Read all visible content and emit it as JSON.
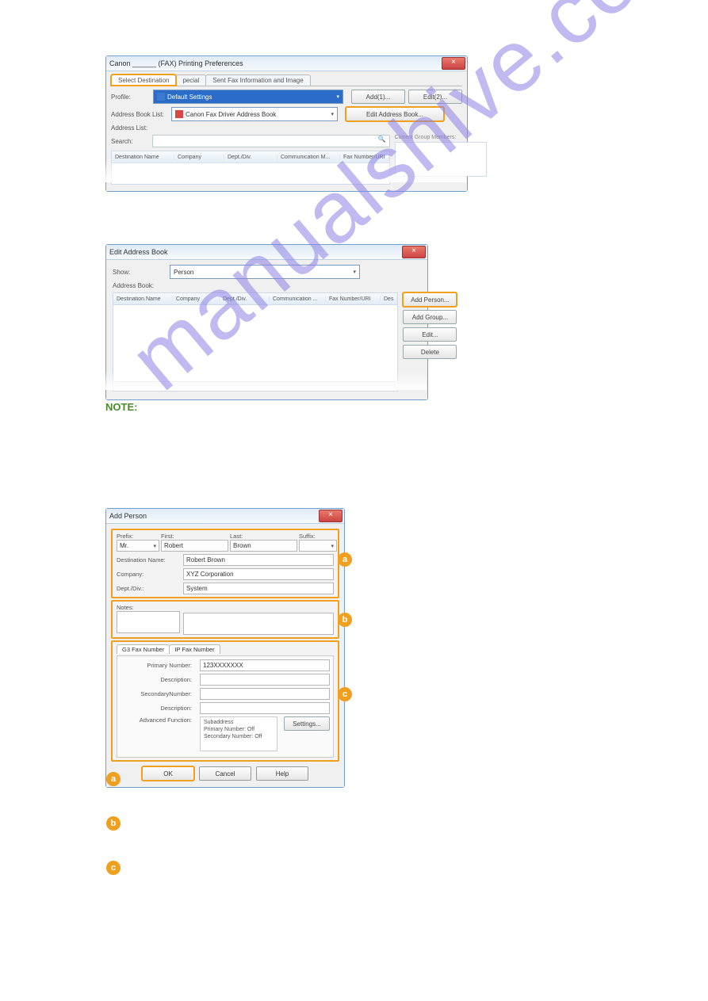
{
  "watermark": "manualshive.com",
  "win1": {
    "title": "Canon ______ (FAX) Printing Preferences",
    "tabs": {
      "sel": "Select Destination",
      "special": "pecial",
      "info": "Sent Fax Information and Image"
    },
    "profile_lbl": "Profile:",
    "profile_val": "Default Settings",
    "add1": "Add(1)...",
    "edit2": "Edit(2)...",
    "abl_lbl": "Address Book List:",
    "abl_val": "Canon Fax Driver Address Book",
    "editab": "Edit Address Book...",
    "al_lbl": "Address List:",
    "search_lbl": "Search:",
    "cgm": "Current Group Members:",
    "cols": {
      "dn": "Destination Name",
      "co": "Company",
      "dd": "Dept./Div.",
      "cm": "Communication M...",
      "fn": "Fax Number/URI"
    }
  },
  "win2": {
    "title": "Edit Address Book",
    "show_lbl": "Show:",
    "show_val": "Person",
    "ab_lbl": "Address Book:",
    "cols": {
      "dn": "Destination Name",
      "co": "Company",
      "dd": "Dept./Div.",
      "cm": "Communication ...",
      "fn": "Fax Number/URI",
      "de": "Des"
    },
    "addp": "Add Person...",
    "addg": "Add Group...",
    "edit": "Edit...",
    "del": "Delete"
  },
  "note": "NOTE:",
  "win3": {
    "title": "Add Person",
    "prefix_lbl": "Prefix:",
    "prefix_val": "Mr.",
    "first_lbl": "First:",
    "first_val": "Robert",
    "last_lbl": "Last:",
    "last_val": "Brown",
    "suffix_lbl": "Suffix:",
    "dname_lbl": "Destination Name:",
    "dname_val": "Robert Brown",
    "comp_lbl": "Company:",
    "comp_val": "XYZ Corporation",
    "dept_lbl": "Dept./Div.:",
    "dept_val": "System",
    "notes_lbl": "Notes:",
    "tab_g3": "G3 Fax Number",
    "tab_ip": "IP Fax Number",
    "pnum_lbl": "Primary Number:",
    "pnum_val": "123XXXXXXX",
    "desc1_lbl": "Description:",
    "snum_lbl": "SecondaryNumber:",
    "desc2_lbl": "Description:",
    "adv_lbl": "Advanced Function:",
    "adv_txt1": "Subaddress",
    "adv_txt2": "Primary Number:    Off",
    "adv_txt3": "Secondary Number: Off",
    "settings": "Settings...",
    "ok": "OK",
    "cancel": "Cancel",
    "help": "Help"
  },
  "badges": {
    "a": "a",
    "b": "b",
    "c": "c"
  }
}
